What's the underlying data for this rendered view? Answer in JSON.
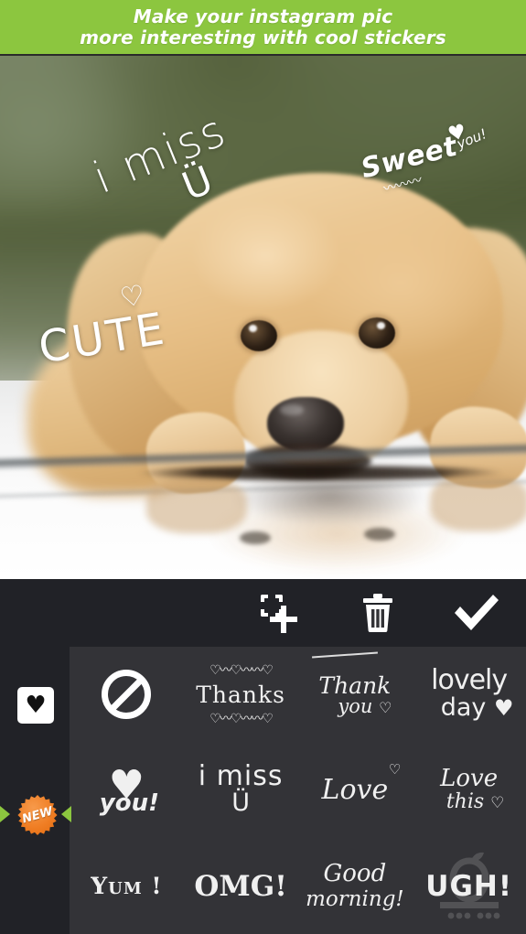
{
  "banner": {
    "line1": "Make your instagram pic",
    "line2": "more interesting with cool stickers",
    "background_color": "#8cc63f",
    "text_color": "#ffffff"
  },
  "photo": {
    "subject": "golden retriever puppy lying on reflective white surface",
    "applied_stickers": [
      {
        "id": "i-miss-u",
        "line1": "i miss",
        "line2": "Ü",
        "rotation_deg": -22
      },
      {
        "id": "sweet-you",
        "word": "Sweet",
        "heart": "♥",
        "you": "you!",
        "wave": "〰〰〰",
        "rotation_deg": -14
      },
      {
        "id": "cute",
        "heart": "♡",
        "word": "CUTE",
        "rotation_deg": -9
      }
    ]
  },
  "toolbar": {
    "background_color": "#212227",
    "buttons": [
      {
        "id": "add-sticker",
        "icon": "add-sticker-icon",
        "label": "Add sticker"
      },
      {
        "id": "delete",
        "icon": "trash-icon",
        "label": "Delete"
      },
      {
        "id": "confirm",
        "icon": "check-icon",
        "label": "Done"
      }
    ]
  },
  "category_rail": {
    "background_color": "#212227",
    "selected_category": {
      "id": "hearts",
      "icon": "heart-icon",
      "selected": true
    },
    "new_badge": {
      "label": "NEW",
      "color": "#ef7d23"
    },
    "arrow_color": "#8cc63f"
  },
  "sticker_grid": {
    "background_color": "#333337",
    "columns": 4,
    "rows": 3,
    "items": [
      {
        "id": "none",
        "type": "no-entry-icon",
        "label": ""
      },
      {
        "id": "thanks",
        "type": "text",
        "ornament_top": "♡〰♡〰〰♡",
        "text": "Thanks",
        "ornament_bottom": "♡〰♡〰〰♡"
      },
      {
        "id": "thank-you",
        "type": "text",
        "line1": "Thank",
        "line2": "you",
        "heart": "♡"
      },
      {
        "id": "lovely-day",
        "type": "text",
        "line1": "lovely",
        "line2": "day",
        "heart": "♥"
      },
      {
        "id": "i-love-you",
        "type": "text",
        "heart": "♥",
        "text": "you!"
      },
      {
        "id": "i-miss-u",
        "type": "text",
        "line1": "i miss",
        "line2": "Ü"
      },
      {
        "id": "love",
        "type": "text",
        "text": "Love",
        "heart": "♡"
      },
      {
        "id": "love-this",
        "type": "text",
        "line1": "Love",
        "line2": "this",
        "heart": "♡"
      },
      {
        "id": "yum",
        "type": "text",
        "text": "Y",
        "text_small": "UM",
        "suffix": "!"
      },
      {
        "id": "omg",
        "type": "text",
        "text": "OMG!"
      },
      {
        "id": "good-morning",
        "type": "text",
        "line1": "Good",
        "line2": "morning!"
      },
      {
        "id": "ugh",
        "type": "text",
        "text": "UGH!",
        "watermark": "apple-logo-watermark"
      }
    ]
  }
}
